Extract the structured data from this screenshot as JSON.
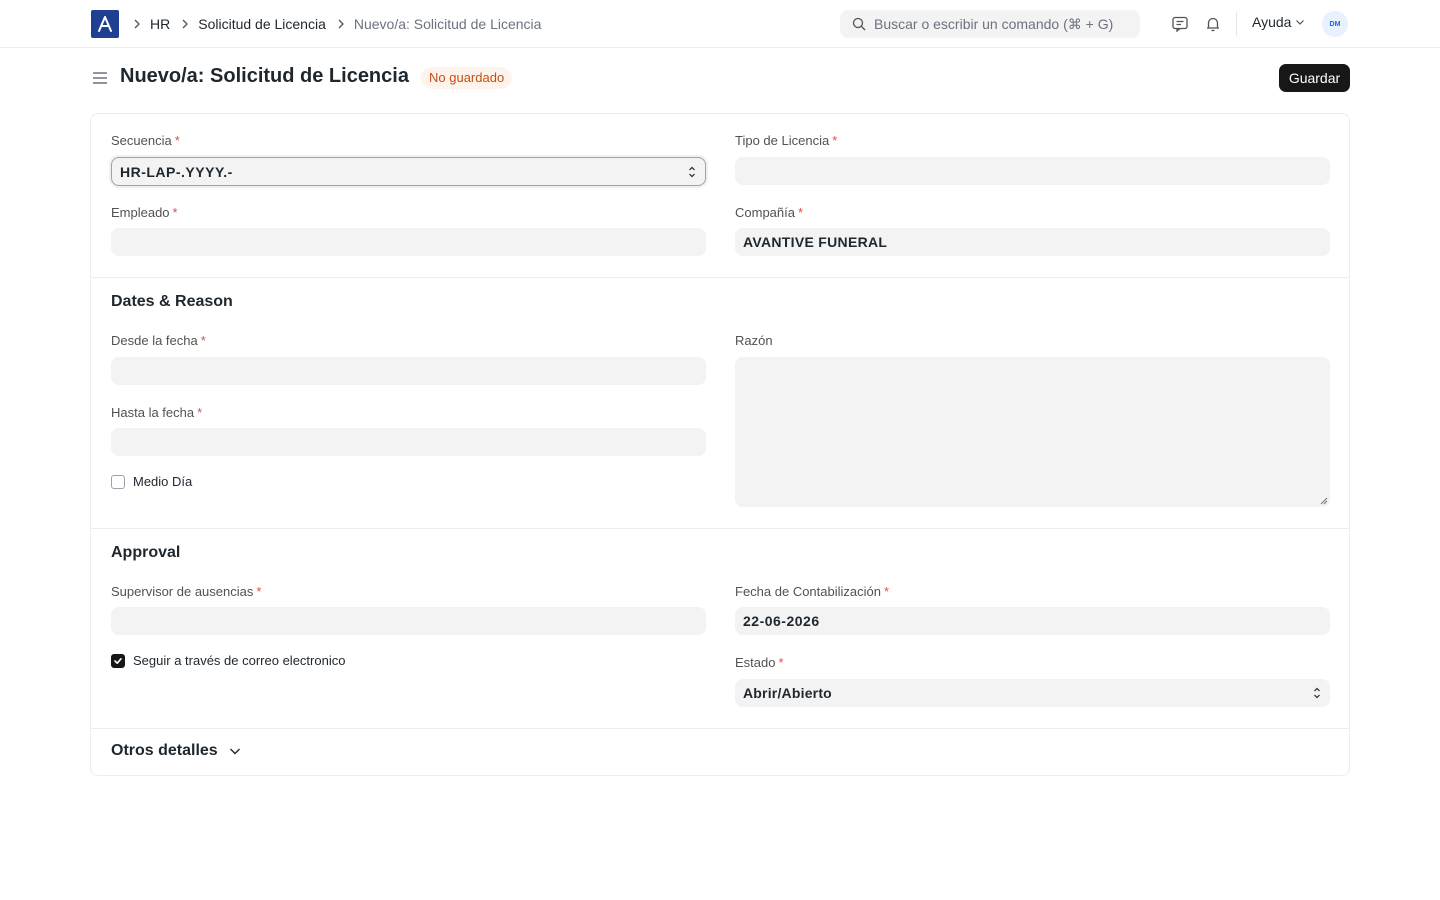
{
  "navbar": {
    "breadcrumbs": [
      "HR",
      "Solicitud de Licencia",
      "Nuevo/a: Solicitud de Licencia"
    ],
    "search_placeholder": "Buscar o escribir un comando (⌘ + G)",
    "help_label": "Ayuda",
    "avatar_initials": "DM"
  },
  "page": {
    "title": "Nuevo/a: Solicitud de Licencia",
    "status_badge": "No guardado",
    "save_label": "Guardar"
  },
  "form": {
    "secuencia": {
      "label": "Secuencia",
      "value": "HR-LAP-.YYYY.-"
    },
    "tipo_licencia": {
      "label": "Tipo de Licencia",
      "value": ""
    },
    "empleado": {
      "label": "Empleado",
      "value": ""
    },
    "compania": {
      "label": "Compañía",
      "value": "AVANTIVE FUNERAL"
    },
    "dates_section": {
      "title": "Dates & Reason",
      "desde": {
        "label": "Desde la fecha",
        "value": ""
      },
      "hasta": {
        "label": "Hasta la fecha",
        "value": ""
      },
      "medio_dia": {
        "label": "Medio Día",
        "checked": false
      },
      "razon": {
        "label": "Razón",
        "value": ""
      }
    },
    "approval_section": {
      "title": "Approval",
      "supervisor": {
        "label": "Supervisor de ausencias",
        "value": ""
      },
      "seguir": {
        "label": "Seguir a través de correo electronico",
        "checked": true
      },
      "fecha_contab": {
        "label": "Fecha de Contabilización",
        "value": "22-06-2026"
      },
      "estado": {
        "label": "Estado",
        "value": "Abrir/Abierto"
      }
    },
    "otros": {
      "title": "Otros detalles"
    }
  },
  "colors": {
    "primary_button": "#171717",
    "logo_bg": "#1f3f93",
    "badge_text": "#c4500f",
    "required_mark": "#e24c4c"
  }
}
